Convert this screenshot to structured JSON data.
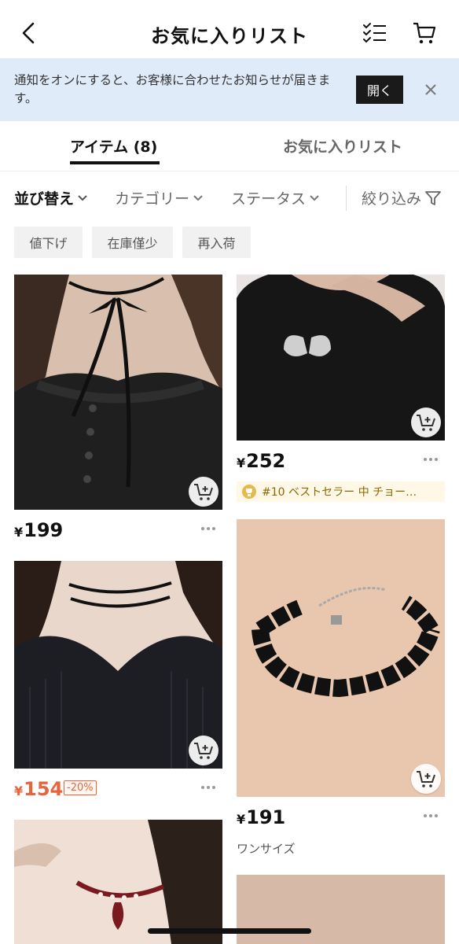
{
  "header": {
    "title": "お気に入りリスト"
  },
  "notice": {
    "text": "通知をオンにすると、お客様に合わせたお知らせが届きます。",
    "open_label": "開く"
  },
  "tabs": {
    "items_label": "アイテム (8)",
    "favorites_label": "お気に入りリスト"
  },
  "filters": {
    "sort": "並び替え",
    "category": "カテゴリー",
    "status": "ステータス",
    "refine": "絞り込み"
  },
  "chips": [
    "値下げ",
    "在庫僅少",
    "再入荷"
  ],
  "products": [
    {
      "currency": "¥",
      "price": "199"
    },
    {
      "currency": "¥",
      "price": "252",
      "badge": "#10 ベストセラー 中 チョー…"
    },
    {
      "currency": "¥",
      "price": "154",
      "discount": "-20%"
    },
    {
      "currency": "¥",
      "price": "191",
      "size": "ワンサイズ"
    }
  ],
  "colors": {
    "notice_bg": "#e0ebfa",
    "sale": "#e8643c",
    "badge_bg": "#fff8e6"
  }
}
